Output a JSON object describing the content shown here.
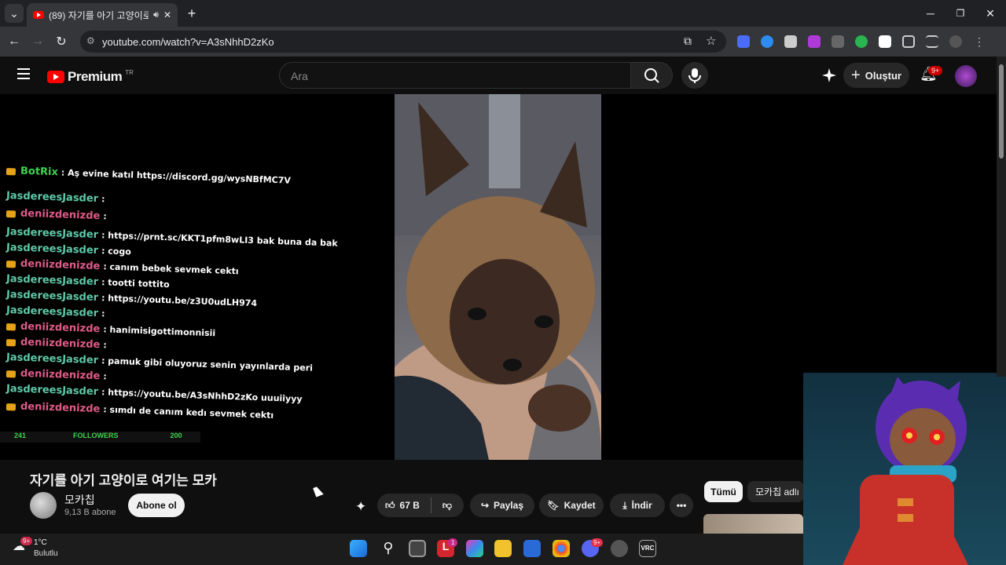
{
  "browser": {
    "tab_title": "(89) 자기를 아기 고양이로 여",
    "url": "youtube.com/watch?v=A3sNhhD2zKo"
  },
  "youtube": {
    "logo": "Premium",
    "region": "TR",
    "search_placeholder": "Ara",
    "create_label": "Oluştur",
    "notif_badge": "9+"
  },
  "chat": {
    "lines": [
      {
        "user": "BotRix",
        "msg": ": Aş evine katıl https://discord.gg/wysNBfMC7V",
        "color": "#3cd34c"
      },
      {
        "user": "JasdereesJasder",
        "msg": ":",
        "color": "#5ec9a8"
      },
      {
        "user": "deniizdenizde",
        "msg": ":",
        "color": "#e05a8a"
      },
      {
        "user": "JasdereesJasder",
        "msg": ": https://prnt.sc/KKT1pfm8wLI3 bak buna da bak",
        "color": "#5ec9a8"
      },
      {
        "user": "JasdereesJasder",
        "msg": ": cogo",
        "color": "#5ec9a8"
      },
      {
        "user": "deniizdenizde",
        "msg": ": canım bebek sevmek cektı",
        "color": "#e05a8a"
      },
      {
        "user": "JasdereesJasder",
        "msg": ": tootti tottito",
        "color": "#5ec9a8"
      },
      {
        "user": "JasdereesJasder",
        "msg": ": https://youtu.be/z3U0udLH974",
        "color": "#5ec9a8"
      },
      {
        "user": "JasdereesJasder",
        "msg": ":",
        "color": "#5ec9a8"
      },
      {
        "user": "deniizdenizde",
        "msg": ": hanimisigottimonnisii",
        "color": "#e05a8a"
      },
      {
        "user": "deniizdenizde",
        "msg": ":",
        "color": "#e05a8a"
      },
      {
        "user": "JasdereesJasder",
        "msg": ": pamuk gibi oluyoruz senin yayınlarda peri",
        "color": "#5ec9a8"
      },
      {
        "user": "deniizdenizde",
        "msg": ":",
        "color": "#e05a8a"
      },
      {
        "user": "JasdereesJasder",
        "msg": ": https://youtu.be/A3sNhhD2zKo uuuiiyyy",
        "color": "#5ec9a8"
      },
      {
        "user": "deniizdenizde",
        "msg": ": sımdı de canım kedı sevmek cektı",
        "color": "#e05a8a"
      }
    ],
    "followers_left": "241",
    "followers_label": "FOLLOWERS",
    "followers_right": "200"
  },
  "video": {
    "title": "자기를 아기 고양이로 여기는 모카",
    "channel": "모카칩",
    "subscribers": "9,13 B abone",
    "subscribe_label": "Abone ol",
    "likes": "67 B",
    "share_label": "Paylaş",
    "save_label": "Kaydet",
    "download_label": "İndir"
  },
  "chips": {
    "all": "Tümü",
    "channel": "모카칩 adlı"
  },
  "weather": {
    "temp": "1°C",
    "desc": "Bulutlu",
    "badge": "9+"
  },
  "taskbar": {
    "badge1": "1",
    "badge2": "9+"
  }
}
